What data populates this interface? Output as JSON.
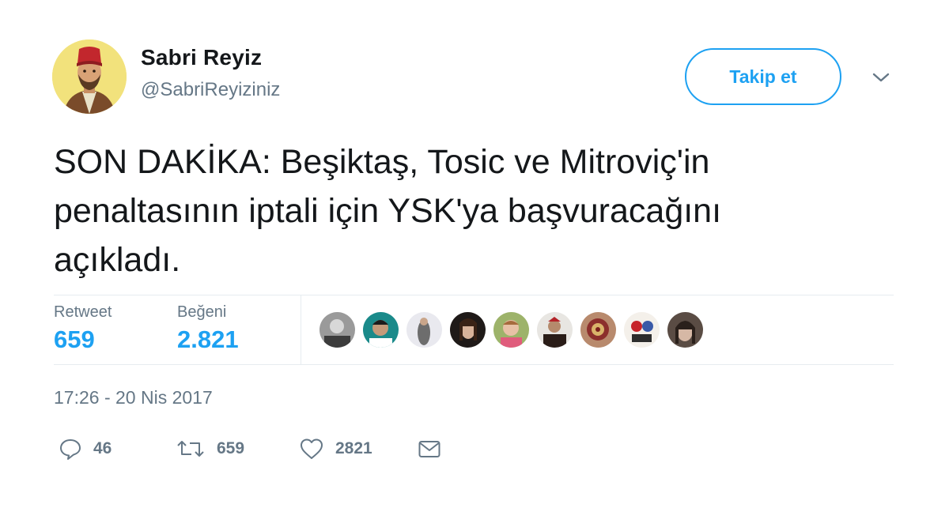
{
  "user": {
    "display_name": "Sabri Reyiz",
    "handle": "@SabriReyiziniz",
    "avatar_icon": "avatar-icon"
  },
  "follow_label": "Takip et",
  "tweet": {
    "line1": "SON DAKİKA: Beşiktaş, Tosic ve Mitroviç'in",
    "line2": "penaltasının iptali için YSK'ya başvuracağını",
    "line3": "açıkladı."
  },
  "stats": {
    "retweet_label": "Retweet",
    "retweet_value": "659",
    "like_label": "Beğeni",
    "like_value": "2.821"
  },
  "timestamp": "17:26 - 20 Nis 2017",
  "actions": {
    "reply_count": "46",
    "retweet_count": "659",
    "like_count": "2821"
  },
  "colors": {
    "accent": "#1da1f2",
    "muted": "#657786",
    "text": "#14171a",
    "divider": "#e6ecf0"
  }
}
